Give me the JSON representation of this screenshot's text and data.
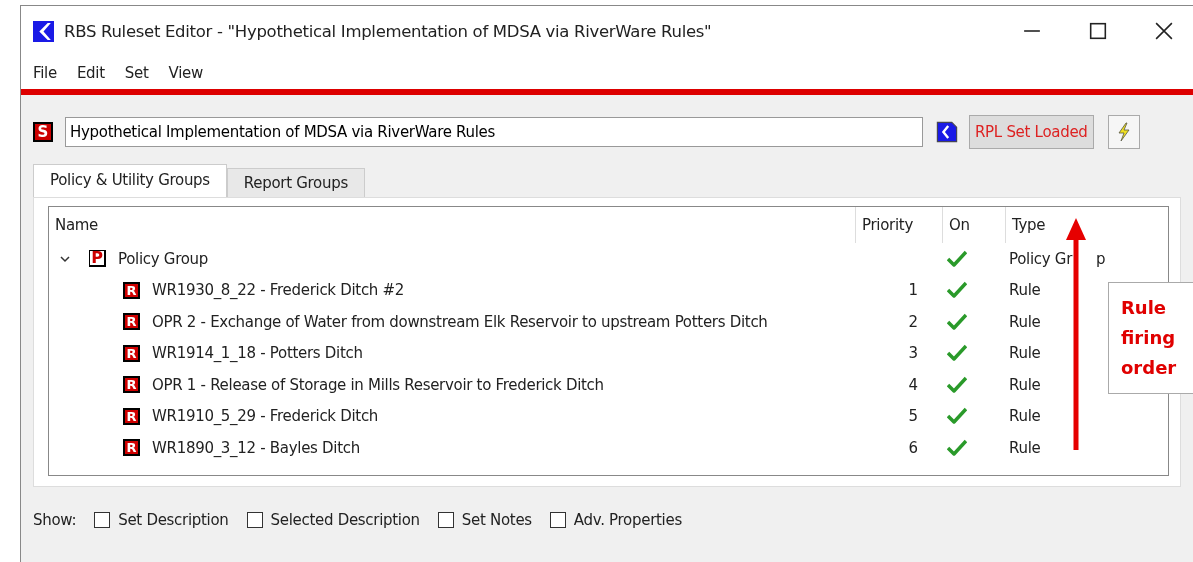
{
  "window": {
    "title": "RBS Ruleset Editor - \"Hypothetical Implementation of MDSA via RiverWare Rules\""
  },
  "menu": [
    "File",
    "Edit",
    "Set",
    "View"
  ],
  "ruleset_name": {
    "badge": "S",
    "value": "Hypothetical Implementation of MDSA via RiverWare Rules"
  },
  "status_button": "RPL Set Loaded",
  "tabs": [
    {
      "label": "Policy & Utility Groups",
      "selected": true
    },
    {
      "label": "Report Groups",
      "selected": false
    }
  ],
  "tree": {
    "columns": [
      "Name",
      "Priority",
      "On",
      "Type"
    ],
    "rows": [
      {
        "name": "Policy Group",
        "kind": "group",
        "badge": "P",
        "priority": "",
        "on": true,
        "type": "Policy Gr",
        "type_rest": "p",
        "expanded": true,
        "children": [
          {
            "name": "WR1930_8_22 - Frederick Ditch #2",
            "kind": "rule",
            "badge": "R",
            "priority": "1",
            "on": true,
            "type": "Rule"
          },
          {
            "name": "OPR 2 - Exchange of Water from downstream Elk Reservoir to upstream Potters Ditch",
            "kind": "rule",
            "badge": "R",
            "priority": "2",
            "on": true,
            "type": "Rule"
          },
          {
            "name": "WR1914_1_18 - Potters Ditch",
            "kind": "rule",
            "badge": "R",
            "priority": "3",
            "on": true,
            "type": "Rule"
          },
          {
            "name": "OPR 1 - Release of Storage in Mills Reservoir to Frederick Ditch",
            "kind": "rule",
            "badge": "R",
            "priority": "4",
            "on": true,
            "type": "Rule"
          },
          {
            "name": "WR1910_5_29 - Frederick Ditch",
            "kind": "rule",
            "badge": "R",
            "priority": "5",
            "on": true,
            "type": "Rule"
          },
          {
            "name": "WR1890_3_12 - Bayles Ditch",
            "kind": "rule",
            "badge": "R",
            "priority": "6",
            "on": true,
            "type": "Rule"
          }
        ]
      }
    ]
  },
  "annotation": {
    "text": "Rule firing order"
  },
  "show": {
    "label": "Show:",
    "options": [
      {
        "label": "Set Description",
        "checked": false
      },
      {
        "label": "Selected Description",
        "checked": false
      },
      {
        "label": "Set Notes",
        "checked": false
      },
      {
        "label": "Adv. Properties",
        "checked": false
      }
    ]
  }
}
